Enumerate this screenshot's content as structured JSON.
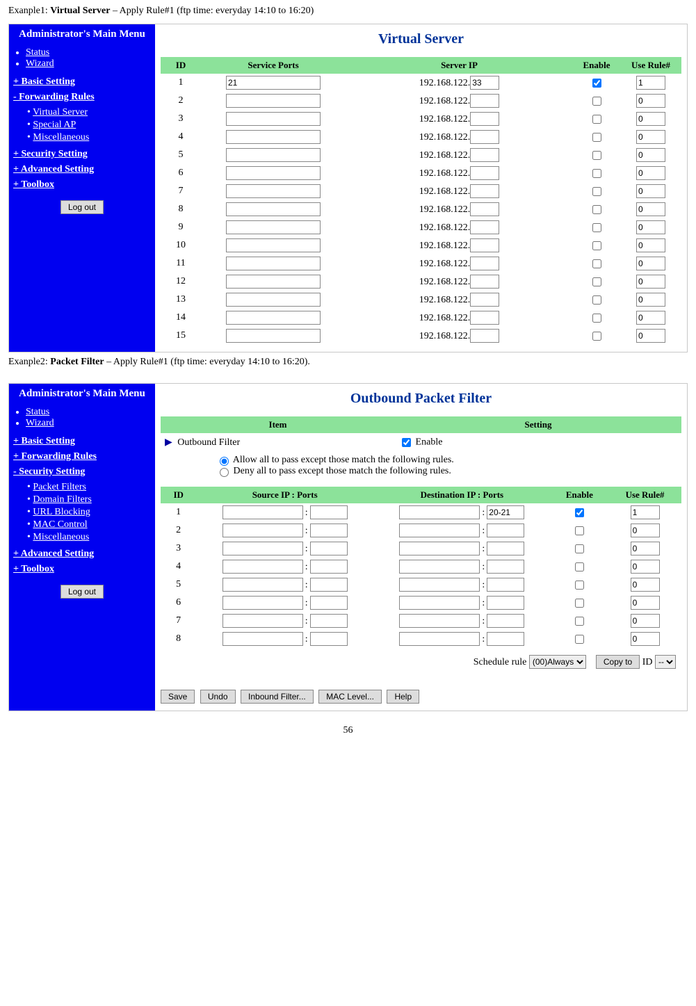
{
  "example1": {
    "label_prefix": "Exanple1: ",
    "label_bold": "Virtual Server",
    "label_suffix": " – Apply Rule#1 (ftp time: everyday 14:10 to 16:20)"
  },
  "example2": {
    "label_prefix": "Exanple2: ",
    "label_bold": "Packet Filter",
    "label_suffix": " – Apply Rule#1 (ftp time: everyday 14:10 to 16:20)."
  },
  "sidebar": {
    "title": "Administrator's Main Menu",
    "status": "Status",
    "wizard": "Wizard",
    "basic": "+ Basic Setting",
    "forwarding_open": "- Forwarding Rules",
    "forwarding_closed": "+ Forwarding Rules",
    "fr_sub": {
      "vs": "Virtual Server",
      "sp": "Special AP",
      "misc": "Miscellaneous"
    },
    "security_closed": "+ Security Setting",
    "security_open": "- Security Setting",
    "ss_sub": {
      "pf": "Packet Filters",
      "df": "Domain Filters",
      "ub": "URL Blocking",
      "mc": "MAC Control",
      "misc": "Miscellaneous"
    },
    "advanced": "+ Advanced Setting",
    "toolbox": "+ Toolbox",
    "logout": "Log out"
  },
  "vs": {
    "title": "Virtual Server",
    "headers": {
      "id": "ID",
      "ports": "Service Ports",
      "ip": "Server IP",
      "enable": "Enable",
      "rule": "Use Rule#"
    },
    "ip_prefix": "192.168.122.",
    "rows": [
      {
        "id": "1",
        "port": "21",
        "ip": "33",
        "enabled": true,
        "rule": "1"
      },
      {
        "id": "2",
        "port": "",
        "ip": "",
        "enabled": false,
        "rule": "0"
      },
      {
        "id": "3",
        "port": "",
        "ip": "",
        "enabled": false,
        "rule": "0"
      },
      {
        "id": "4",
        "port": "",
        "ip": "",
        "enabled": false,
        "rule": "0"
      },
      {
        "id": "5",
        "port": "",
        "ip": "",
        "enabled": false,
        "rule": "0"
      },
      {
        "id": "6",
        "port": "",
        "ip": "",
        "enabled": false,
        "rule": "0"
      },
      {
        "id": "7",
        "port": "",
        "ip": "",
        "enabled": false,
        "rule": "0"
      },
      {
        "id": "8",
        "port": "",
        "ip": "",
        "enabled": false,
        "rule": "0"
      },
      {
        "id": "9",
        "port": "",
        "ip": "",
        "enabled": false,
        "rule": "0"
      },
      {
        "id": "10",
        "port": "",
        "ip": "",
        "enabled": false,
        "rule": "0"
      },
      {
        "id": "11",
        "port": "",
        "ip": "",
        "enabled": false,
        "rule": "0"
      },
      {
        "id": "12",
        "port": "",
        "ip": "",
        "enabled": false,
        "rule": "0"
      },
      {
        "id": "13",
        "port": "",
        "ip": "",
        "enabled": false,
        "rule": "0"
      },
      {
        "id": "14",
        "port": "",
        "ip": "",
        "enabled": false,
        "rule": "0"
      },
      {
        "id": "15",
        "port": "",
        "ip": "",
        "enabled": false,
        "rule": "0"
      }
    ]
  },
  "pf": {
    "title": "Outbound Packet Filter",
    "item_headers": {
      "item": "Item",
      "setting": "Setting"
    },
    "outbound_label": "Outbound Filter",
    "enable_label": "Enable",
    "allow_label": "Allow all to pass except those match the following rules.",
    "deny_label": "Deny all to pass except those match the following rules.",
    "headers": {
      "id": "ID",
      "src": "Source IP : Ports",
      "dst": "Destination IP : Ports",
      "enable": "Enable",
      "rule": "Use Rule#"
    },
    "rows": [
      {
        "id": "1",
        "src_ip": "",
        "src_port": "",
        "dst_ip": "",
        "dst_port": "20-21",
        "enabled": true,
        "rule": "1"
      },
      {
        "id": "2",
        "src_ip": "",
        "src_port": "",
        "dst_ip": "",
        "dst_port": "",
        "enabled": false,
        "rule": "0"
      },
      {
        "id": "3",
        "src_ip": "",
        "src_port": "",
        "dst_ip": "",
        "dst_port": "",
        "enabled": false,
        "rule": "0"
      },
      {
        "id": "4",
        "src_ip": "",
        "src_port": "",
        "dst_ip": "",
        "dst_port": "",
        "enabled": false,
        "rule": "0"
      },
      {
        "id": "5",
        "src_ip": "",
        "src_port": "",
        "dst_ip": "",
        "dst_port": "",
        "enabled": false,
        "rule": "0"
      },
      {
        "id": "6",
        "src_ip": "",
        "src_port": "",
        "dst_ip": "",
        "dst_port": "",
        "enabled": false,
        "rule": "0"
      },
      {
        "id": "7",
        "src_ip": "",
        "src_port": "",
        "dst_ip": "",
        "dst_port": "",
        "enabled": false,
        "rule": "0"
      },
      {
        "id": "8",
        "src_ip": "",
        "src_port": "",
        "dst_ip": "",
        "dst_port": "",
        "enabled": false,
        "rule": "0"
      }
    ],
    "schedule_label": "Schedule rule",
    "schedule_value": "(00)Always",
    "copyto_label": "Copy to",
    "id_label": "ID",
    "id_value": "--",
    "buttons": {
      "save": "Save",
      "undo": "Undo",
      "inbound": "Inbound Filter...",
      "mac": "MAC Level...",
      "help": "Help"
    }
  },
  "page_number": "56"
}
